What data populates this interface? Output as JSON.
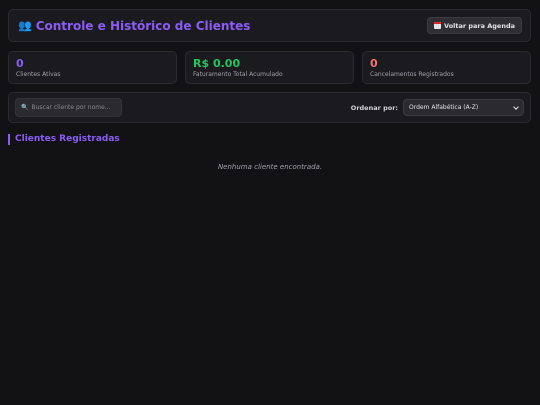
{
  "header": {
    "title": "Controle e Histórico de Clientes",
    "title_icon": "users-icon",
    "back_label": "Voltar para Agenda"
  },
  "stats": [
    {
      "value": "0",
      "label": "Clientes Ativas",
      "color": "#8b5cf6"
    },
    {
      "value": "R$ 0.00",
      "label": "Faturamento Total Acumulado",
      "color": "#22c55e"
    },
    {
      "value": "0",
      "label": "Cancelamentos Registrados",
      "color": "#f87171"
    }
  ],
  "toolbar": {
    "search_placeholder": "Buscar cliente por nome...",
    "sort_label": "Ordenar por:",
    "sort_selected": "Ordem Alfabética (A-Z)"
  },
  "section": {
    "title": "Clientes Registradas",
    "empty_text": "Nenhuma cliente encontrada."
  },
  "colors": {
    "accent": "#8b5cf6",
    "background": "#121214",
    "panel": "#1b1b1f"
  }
}
